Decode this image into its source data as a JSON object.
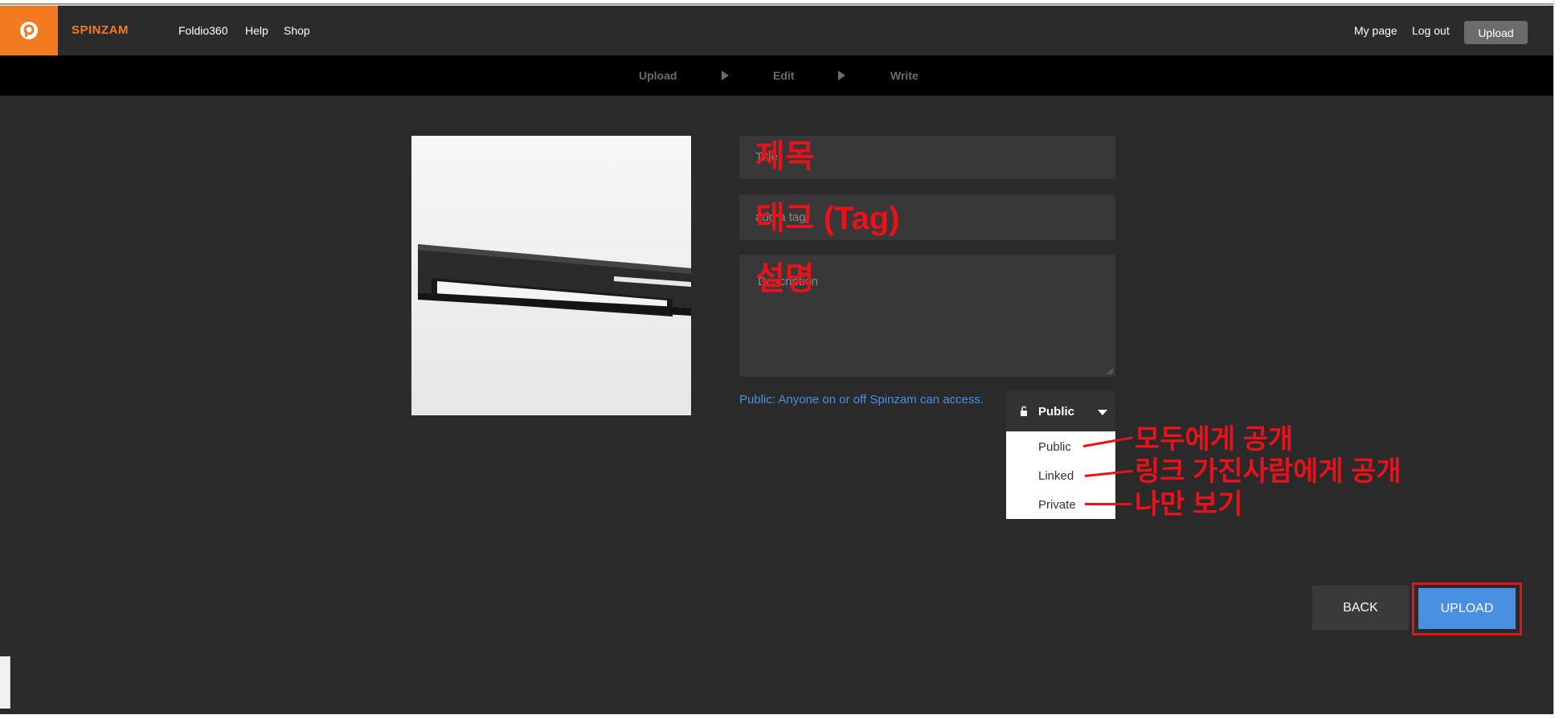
{
  "header": {
    "brand": "SPINZAM",
    "nav": [
      "Foldio360",
      "Help",
      "Shop"
    ],
    "my_page": "My page",
    "log_out": "Log out",
    "upload": "Upload"
  },
  "steps": [
    "Upload",
    "Edit",
    "Write"
  ],
  "form": {
    "title_placeholder": "Title",
    "tag_placeholder": "add a tag",
    "description_placeholder": "Description",
    "public_note": "Public: Anyone on or off Spinzam can access."
  },
  "privacy": {
    "selected": "Public",
    "options": [
      "Public",
      "Linked",
      "Private"
    ]
  },
  "annotations": {
    "title": "제목",
    "tag": "태그 (Tag)",
    "description": "설명",
    "public": "모두에게 공개",
    "linked": "링크 가진사람에게 공개",
    "private": "나만 보기"
  },
  "buttons": {
    "back": "BACK",
    "upload": "UPLOAD"
  },
  "colors": {
    "accent_orange": "#f47a20",
    "primary_blue": "#4a90e2",
    "annotation_red": "#e8121b",
    "background": "#2a2a2a"
  }
}
